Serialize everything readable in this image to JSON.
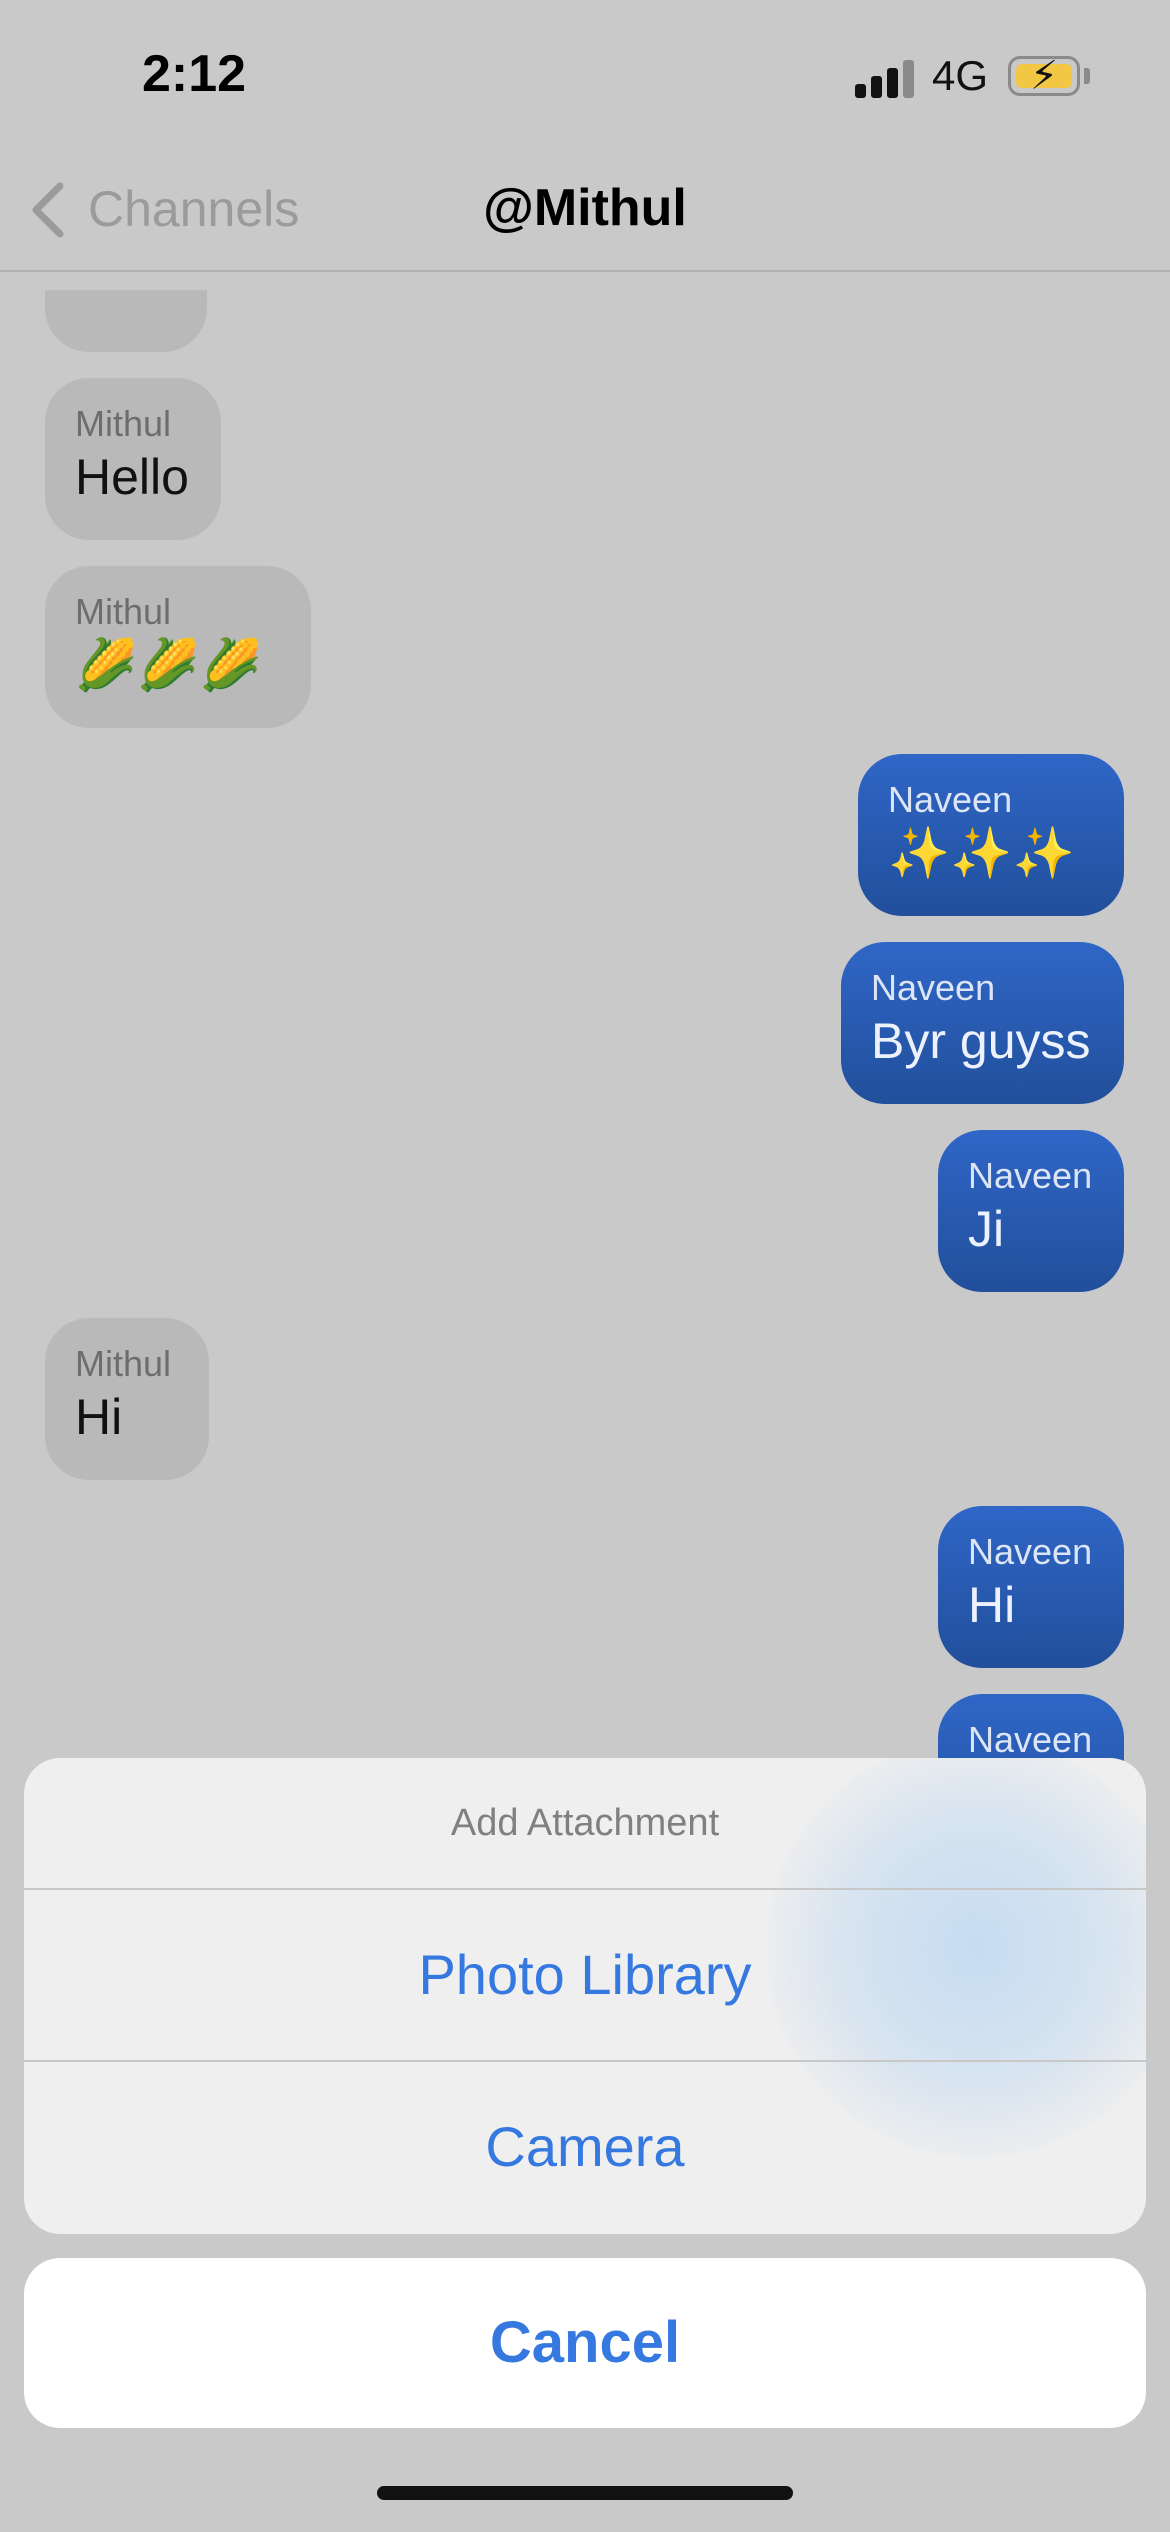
{
  "status_bar": {
    "time": "2:12",
    "network": "4G",
    "battery_charging": true,
    "icons": [
      "signal-icon",
      "battery-charging-icon"
    ]
  },
  "nav": {
    "back_label": "Channels",
    "title": "@Mithul",
    "icons": [
      "chevron-left-icon"
    ]
  },
  "messages": [
    {
      "sender": "Mithul",
      "text": "Hello",
      "direction": "incoming"
    },
    {
      "sender": "Mithul",
      "text": "🌽🌽🌽",
      "direction": "incoming"
    },
    {
      "sender": "Naveen",
      "text": "✨✨✨",
      "direction": "outgoing"
    },
    {
      "sender": "Naveen",
      "text": "Byr guyss",
      "direction": "outgoing"
    },
    {
      "sender": "Naveen",
      "text": "Ji",
      "direction": "outgoing"
    },
    {
      "sender": "Mithul",
      "text": "Hi",
      "direction": "incoming"
    },
    {
      "sender": "Naveen",
      "text": "Hi",
      "direction": "outgoing"
    },
    {
      "sender": "Naveen",
      "text": "",
      "direction": "outgoing"
    }
  ],
  "action_sheet": {
    "title": "Add Attachment",
    "options": [
      "Photo Library",
      "Camera"
    ],
    "cancel_label": "Cancel"
  },
  "colors": {
    "incoming_bubble": "#b9b9b9",
    "outgoing_bubble": "#2b5fb8",
    "action_blue": "#3478e0",
    "dimmed_background": "#c9c9c9"
  }
}
